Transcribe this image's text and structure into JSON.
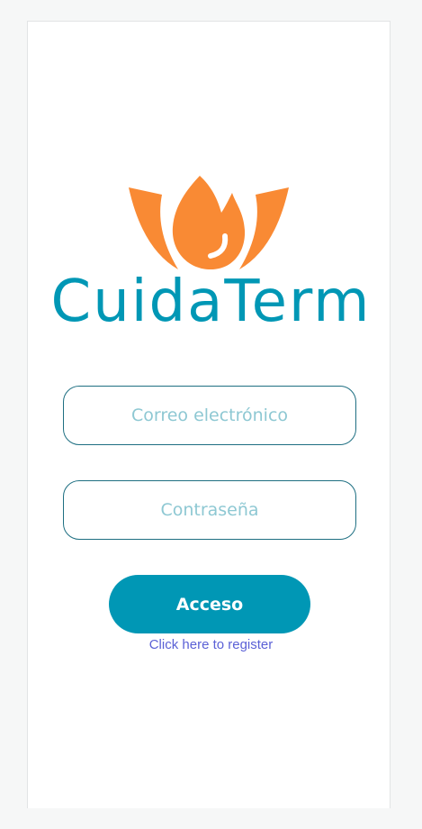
{
  "colors": {
    "brand_teal": "#0097b5",
    "flame_orange": "#f98a34",
    "field_border": "#1e6f82",
    "link": "#5b61d6"
  },
  "logo": {
    "brand_name": "CuidaTerm"
  },
  "form": {
    "email_placeholder": "Correo electrónico",
    "password_placeholder": "Contraseña",
    "submit_label": "Acceso"
  },
  "register_link": "Click here to register"
}
